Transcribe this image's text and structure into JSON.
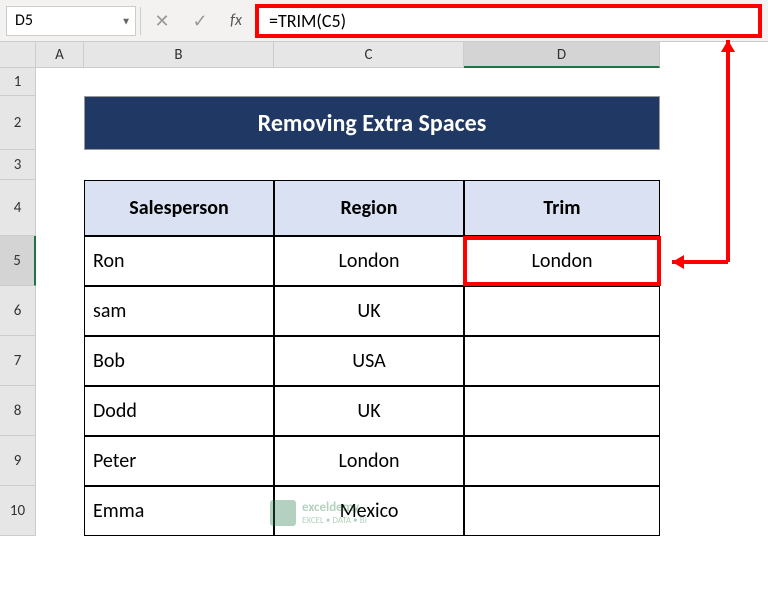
{
  "nameBox": "D5",
  "formula": "=TRIM(C5)",
  "columns": {
    "A": "A",
    "B": "B",
    "C": "C",
    "D": "D"
  },
  "rowLabels": [
    "1",
    "2",
    "3",
    "4",
    "5",
    "6",
    "7",
    "8",
    "9",
    "10"
  ],
  "title": "Removing Extra Spaces",
  "headers": {
    "b": "Salesperson",
    "c": "Region",
    "d": "Trim"
  },
  "data": [
    {
      "b": "Ron",
      "c": "London",
      "d": "London"
    },
    {
      "b": "sam",
      "c": "UK",
      "d": ""
    },
    {
      "b": "Bob",
      "c": "USA",
      "d": ""
    },
    {
      "b": "Dodd",
      "c": "UK",
      "d": ""
    },
    {
      "b": "Peter",
      "c": "London",
      "d": ""
    },
    {
      "b": "Emma",
      "c": "Mexico",
      "d": ""
    }
  ],
  "watermark": {
    "brand": "exceldemy",
    "tag": "EXCEL • DATA • BI"
  }
}
